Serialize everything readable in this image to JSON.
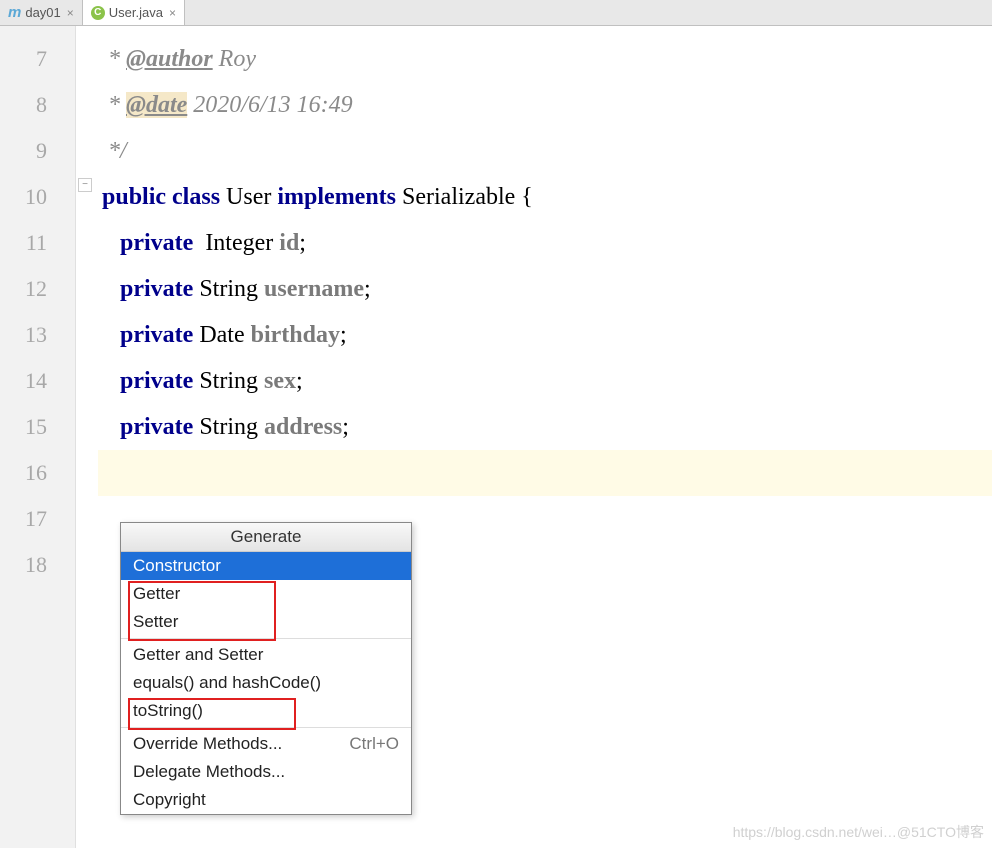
{
  "tabs": [
    {
      "icon": "m",
      "label": "day01",
      "active": false
    },
    {
      "icon": "c",
      "label": "User.java",
      "active": true
    }
  ],
  "gutter": [
    "7",
    "8",
    "9",
    "10",
    "11",
    "12",
    "13",
    "14",
    "15",
    "16",
    "17",
    "18"
  ],
  "code": {
    "l7": {
      "prefix": " * ",
      "tag": "@author",
      "rest": " Roy"
    },
    "l8": {
      "prefix": " * ",
      "tag": "@date",
      "rest": " 2020/6/13 16:49"
    },
    "l9": " */",
    "l10": {
      "kw1": "public class",
      "name": " User ",
      "kw2": "implements",
      "impl": " Serializable {"
    },
    "l11": {
      "kw": "private",
      "type": "  Integer ",
      "field": "id",
      "sc": ";"
    },
    "l12": {
      "kw": "private",
      "type": " String ",
      "field": "username",
      "sc": ";"
    },
    "l13": {
      "kw": "private",
      "type": " Date ",
      "field": "birthday",
      "sc": ";"
    },
    "l14": {
      "kw": "private",
      "type": " String ",
      "field": "sex",
      "sc": ";"
    },
    "l15": {
      "kw": "private",
      "type": " String ",
      "field": "address",
      "sc": ";"
    }
  },
  "popup": {
    "title": "Generate",
    "items": [
      {
        "label": "Constructor",
        "selected": true
      },
      {
        "label": "Getter"
      },
      {
        "label": "Setter"
      },
      {
        "sep": true
      },
      {
        "label": "Getter and Setter"
      },
      {
        "label": "equals() and hashCode()"
      },
      {
        "label": "toString()"
      },
      {
        "sep": true
      },
      {
        "label": "Override Methods...",
        "shortcut": "Ctrl+O"
      },
      {
        "label": "Delegate Methods..."
      },
      {
        "label": "Copyright"
      }
    ]
  },
  "watermark": "https://blog.csdn.net/wei…@51CTO博客"
}
